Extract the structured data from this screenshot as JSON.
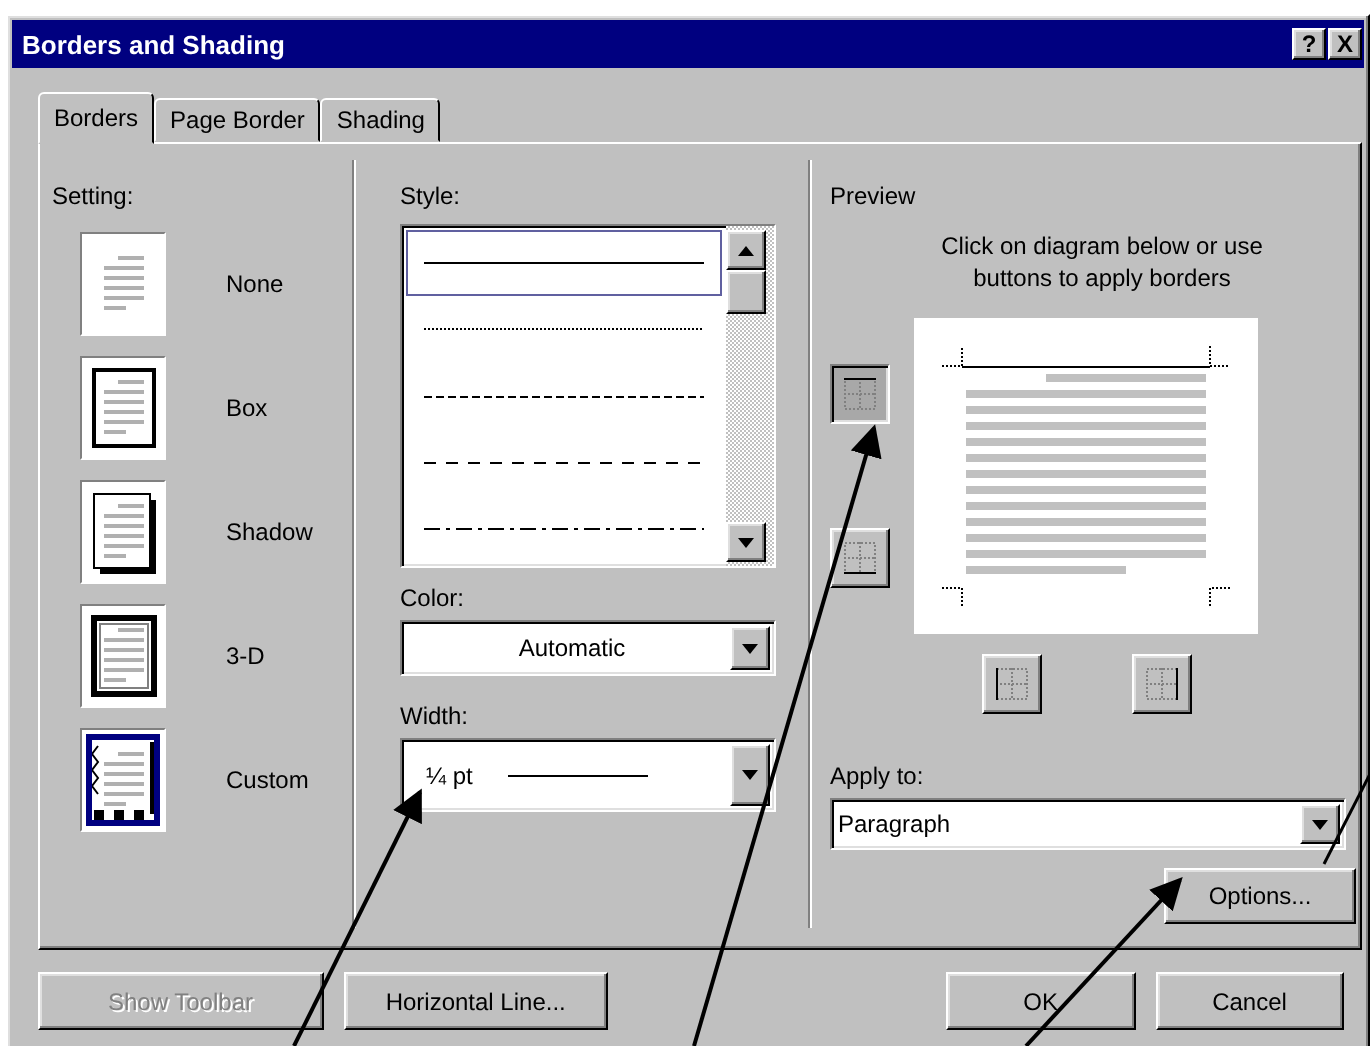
{
  "window": {
    "title": "Borders and Shading",
    "help_button": "?",
    "close_button": "X"
  },
  "tabs": [
    {
      "label": "Borders",
      "selected": true
    },
    {
      "label": "Page Border",
      "selected": false
    },
    {
      "label": "Shading",
      "selected": false
    }
  ],
  "setting": {
    "label": "Setting:",
    "options": [
      {
        "kind": "none",
        "label": "None",
        "selected": false
      },
      {
        "kind": "box",
        "label": "Box",
        "selected": false
      },
      {
        "kind": "shadow",
        "label": "Shadow",
        "selected": false
      },
      {
        "kind": "threed",
        "label": "3-D",
        "selected": false
      },
      {
        "kind": "custom",
        "label": "Custom",
        "selected": true
      }
    ]
  },
  "style": {
    "label": "Style:",
    "lines": [
      {
        "kind": "solid",
        "selected": true
      },
      {
        "kind": "dotted",
        "selected": false
      },
      {
        "kind": "dashed",
        "selected": false
      },
      {
        "kind": "long-dash",
        "selected": false
      },
      {
        "kind": "dash-dot",
        "selected": false
      }
    ]
  },
  "color": {
    "label": "Color:",
    "value": "Automatic"
  },
  "width": {
    "label": "Width:",
    "value": "¼ pt"
  },
  "preview": {
    "label": "Preview",
    "instructions": "Click on diagram below or use buttons to apply borders",
    "border_buttons": [
      {
        "kind": "top",
        "selected": true
      },
      {
        "kind": "bottom",
        "selected": false
      },
      {
        "kind": "left",
        "selected": false
      },
      {
        "kind": "right",
        "selected": false
      }
    ]
  },
  "apply_to": {
    "label": "Apply to:",
    "value": "Paragraph"
  },
  "options_button": "Options...",
  "buttons": [
    {
      "label": "Show Toolbar",
      "disabled": true
    },
    {
      "label": "Horizontal Line...",
      "disabled": false
    },
    {
      "label": "OK",
      "disabled": false
    },
    {
      "label": "Cancel",
      "disabled": false
    }
  ]
}
